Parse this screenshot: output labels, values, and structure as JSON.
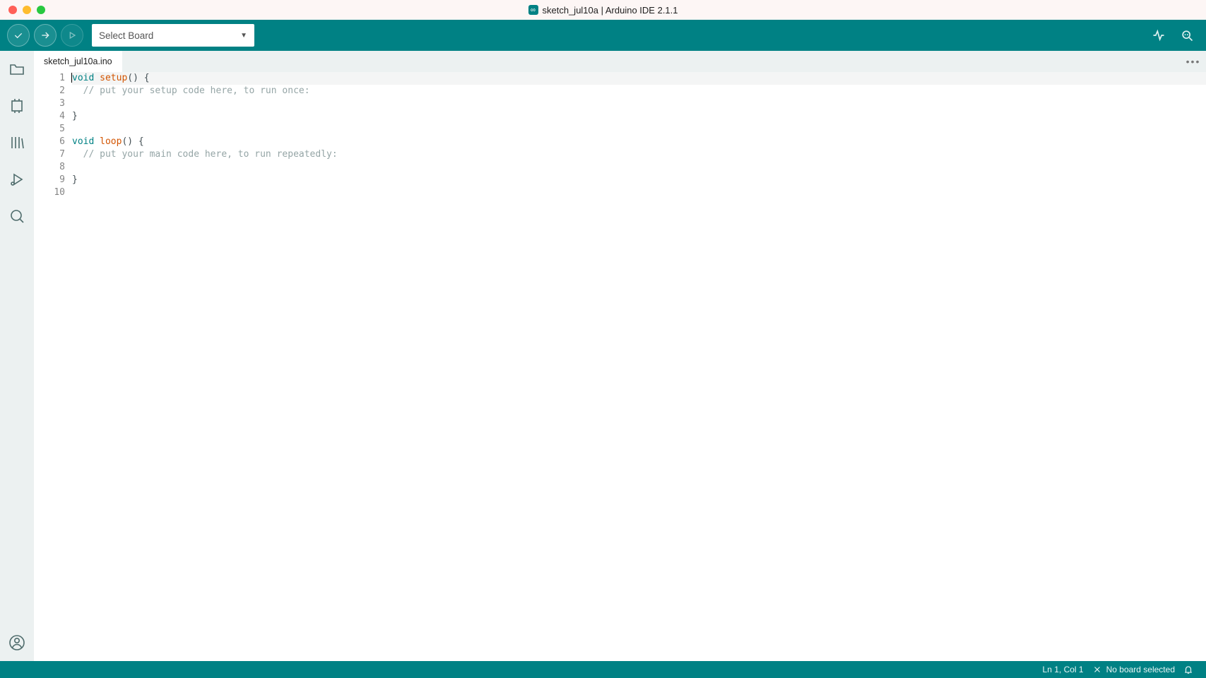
{
  "window": {
    "title": "sketch_jul10a | Arduino IDE 2.1.1"
  },
  "toolbar": {
    "board_placeholder": "Select Board"
  },
  "tabs": [
    {
      "label": "sketch_jul10a.ino"
    }
  ],
  "code": {
    "lines": [
      {
        "n": 1,
        "highlight": true,
        "tokens": [
          {
            "t": "void",
            "c": "k"
          },
          {
            "t": " "
          },
          {
            "t": "setup",
            "c": "fn"
          },
          {
            "t": "() {",
            "c": "p"
          }
        ],
        "cursor_before": true
      },
      {
        "n": 2,
        "tokens": [
          {
            "t": "  "
          },
          {
            "t": "// put your setup code here, to run once:",
            "c": "cm"
          }
        ]
      },
      {
        "n": 3,
        "tokens": [
          {
            "t": ""
          }
        ]
      },
      {
        "n": 4,
        "tokens": [
          {
            "t": "}",
            "c": "p"
          }
        ]
      },
      {
        "n": 5,
        "tokens": [
          {
            "t": ""
          }
        ]
      },
      {
        "n": 6,
        "tokens": [
          {
            "t": "void",
            "c": "k"
          },
          {
            "t": " "
          },
          {
            "t": "loop",
            "c": "fn"
          },
          {
            "t": "() {",
            "c": "p"
          }
        ]
      },
      {
        "n": 7,
        "tokens": [
          {
            "t": "  "
          },
          {
            "t": "// put your main code here, to run repeatedly:",
            "c": "cm"
          }
        ]
      },
      {
        "n": 8,
        "tokens": [
          {
            "t": ""
          }
        ]
      },
      {
        "n": 9,
        "tokens": [
          {
            "t": "}",
            "c": "p"
          }
        ]
      },
      {
        "n": 10,
        "tokens": [
          {
            "t": ""
          }
        ]
      }
    ]
  },
  "status": {
    "position": "Ln 1, Col 1",
    "board": "No board selected"
  }
}
